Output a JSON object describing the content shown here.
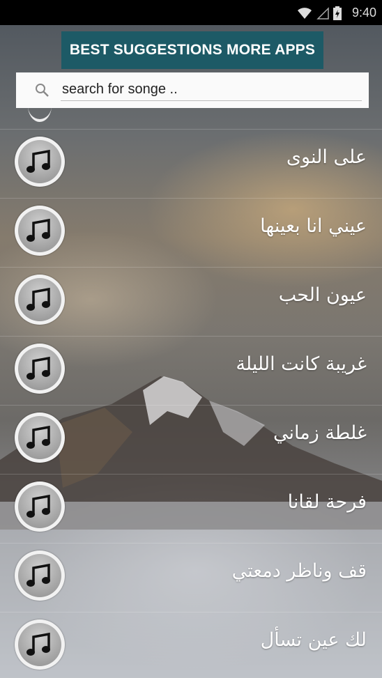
{
  "status_bar": {
    "time": "9:40",
    "icons": [
      "wifi-icon",
      "signal-icon",
      "battery-icon"
    ]
  },
  "top_banner": {
    "label": "BEST SUGGESTIONS MORE APPS",
    "color": "#1d5a66"
  },
  "search": {
    "placeholder": "search for songe ..",
    "value": ""
  },
  "songs": [
    {
      "title": "على النوى"
    },
    {
      "title": "عيني انا بعينها"
    },
    {
      "title": "عيون الحب"
    },
    {
      "title": "غريبة كانت الليلة"
    },
    {
      "title": "غلطة زماني"
    },
    {
      "title": "فرحة لقانا"
    },
    {
      "title": "قف وناظر دمعتي"
    },
    {
      "title": "لك عين تسأل"
    }
  ]
}
